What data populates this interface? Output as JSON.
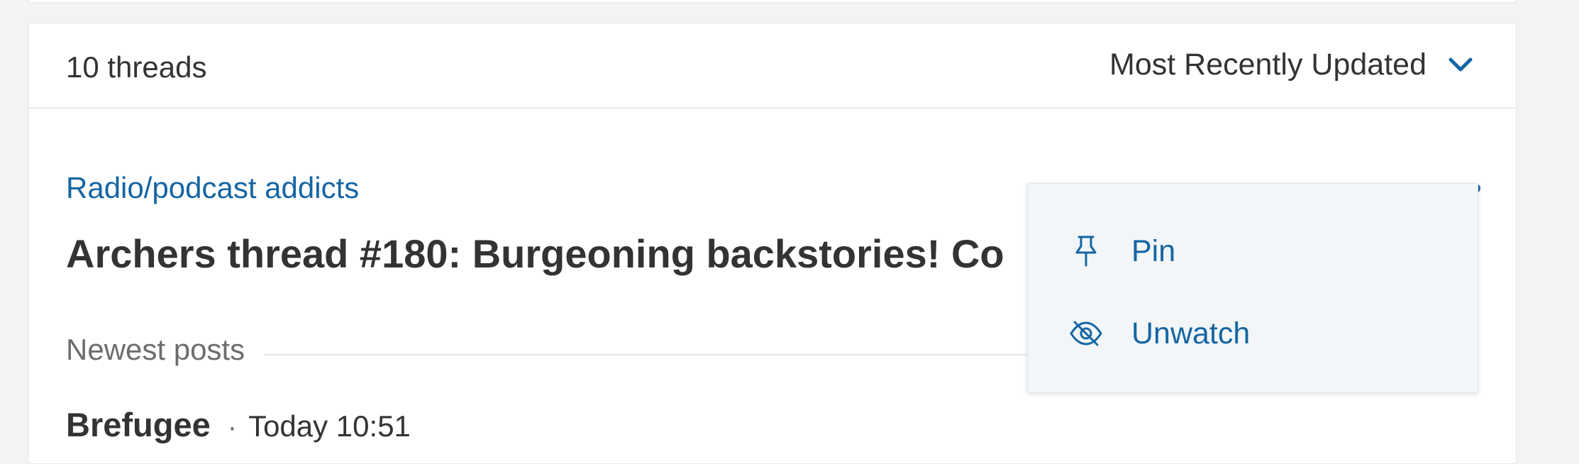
{
  "header": {
    "thread_count": "10 threads",
    "sort_label": "Most Recently Updated",
    "sort_icon": "chevron-down-icon"
  },
  "thread": {
    "category": "Radio/podcast addicts",
    "title": "Archers thread #180: Burgeoning backstories! Co",
    "newest_label": "Newest posts",
    "post": {
      "author": "Brefugee",
      "separator": "·",
      "time": "Today 10:51"
    },
    "more_icon": "more-horizontal-icon"
  },
  "menu": {
    "items": [
      {
        "label": "Pin",
        "icon": "pin-icon"
      },
      {
        "label": "Unwatch",
        "icon": "eye-slash-icon"
      }
    ]
  },
  "colors": {
    "link": "#1565a3",
    "text": "#333333",
    "muted": "#6d6d6d",
    "menu_bg": "#f2f6f8",
    "page_bg": "#f1f3f4"
  }
}
